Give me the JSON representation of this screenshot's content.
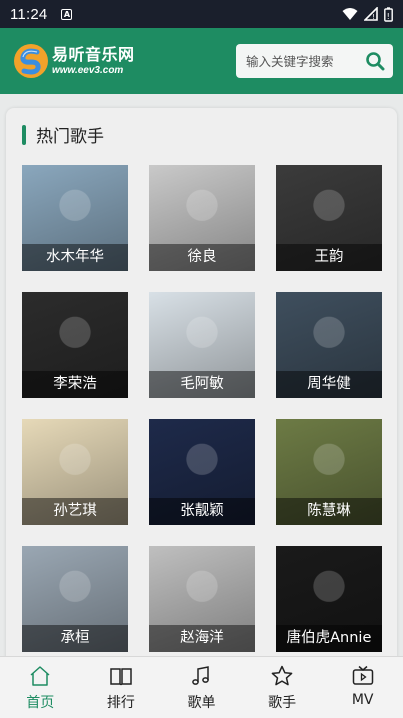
{
  "status": {
    "time": "11:24"
  },
  "header": {
    "logo_title": "易听音乐网",
    "logo_url": "www.eev3.com",
    "search_placeholder": "输入关键字搜索",
    "colors": {
      "brand": "#1e8c62"
    }
  },
  "section": {
    "title": "热门歌手"
  },
  "singers": [
    {
      "name": "水木年华",
      "bg": "#8aa7bd"
    },
    {
      "name": "徐良",
      "bg": "#c9c9c9"
    },
    {
      "name": "王韵",
      "bg": "#3b3b3b"
    },
    {
      "name": "李荣浩",
      "bg": "#2c2c2c"
    },
    {
      "name": "毛阿敏",
      "bg": "#d8e0e6"
    },
    {
      "name": "周华健",
      "bg": "#3f4f5e"
    },
    {
      "name": "孙艺琪",
      "bg": "#e6d9b8"
    },
    {
      "name": "张靓颖",
      "bg": "#1e2a4a"
    },
    {
      "name": "陈慧琳",
      "bg": "#6d7b45"
    },
    {
      "name": "承桓",
      "bg": "#9aa7b3"
    },
    {
      "name": "赵海洋",
      "bg": "#bfbfbf"
    },
    {
      "name": "唐伯虎Annie",
      "bg": "#1a1a1a"
    }
  ],
  "nav": [
    {
      "label": "首页",
      "icon": "home-icon",
      "active": true
    },
    {
      "label": "排行",
      "icon": "book-icon",
      "active": false
    },
    {
      "label": "歌单",
      "icon": "music-note-icon",
      "active": false
    },
    {
      "label": "歌手",
      "icon": "star-icon",
      "active": false
    },
    {
      "label": "MV",
      "icon": "tv-icon",
      "active": false
    }
  ]
}
